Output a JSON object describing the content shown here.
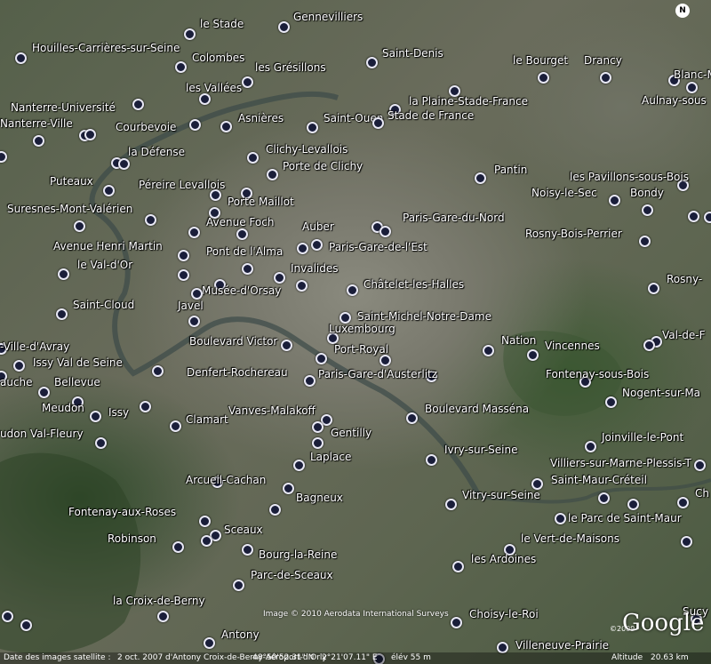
{
  "map": {
    "compass_letter": "N",
    "stations": [
      {
        "label": "le Stade",
        "dot": [
          212,
          37
        ],
        "text": [
          225,
          20
        ]
      },
      {
        "label": "Gennevilliers",
        "dot": [
          318,
          29
        ],
        "text": [
          330,
          12
        ]
      },
      {
        "label": "Houilles-Carrières-sur-Seine",
        "dot": [
          22,
          64
        ],
        "text": [
          36,
          47
        ]
      },
      {
        "label": "Colombes",
        "dot": [
          202,
          74
        ],
        "text": [
          216,
          58
        ]
      },
      {
        "label": "les Grésillons",
        "dot": [
          277,
          91
        ],
        "text": [
          287,
          69
        ]
      },
      {
        "label": "Saint-Denis",
        "dot": [
          417,
          69
        ],
        "text": [
          430,
          53
        ]
      },
      {
        "label": "le Bourget",
        "dot": [
          610,
          86
        ],
        "text": [
          577,
          61
        ]
      },
      {
        "label": "Drancy",
        "dot": [
          680,
          86
        ],
        "text": [
          657,
          61
        ]
      },
      {
        "label": "Blanc-M",
        "dot": [
          757,
          89
        ],
        "text": [
          758,
          77
        ]
      },
      {
        "label": "les Vallées",
        "dot": [
          229,
          110
        ],
        "text": [
          209,
          92
        ]
      },
      {
        "label": "Aulnay-sous",
        "dot": [
          777,
          97
        ],
        "text": [
          722,
          106
        ]
      },
      {
        "label": "Nanterre-Université",
        "dot": [
          154,
          116
        ],
        "text": [
          12,
          114
        ]
      },
      {
        "label": "la Plaine-Stade-France",
        "dot": [
          510,
          101
        ],
        "text": [
          460,
          107
        ]
      },
      {
        "label": "Asnières",
        "dot": [
          253,
          141
        ],
        "text": [
          268,
          126
        ]
      },
      {
        "label": "Saint-Ouen",
        "dot": [
          350,
          142
        ],
        "text": [
          364,
          126
        ]
      },
      {
        "label": "Stade de France",
        "dot": [
          443,
          122
        ],
        "text": [
          436,
          123
        ]
      },
      {
        "label": "Nanterre-Ville",
        "dot": [
          94,
          151
        ],
        "text": [
          0,
          132
        ]
      },
      {
        "label": "Courbevoie",
        "dot": [
          218,
          139
        ],
        "text": [
          130,
          136
        ]
      },
      {
        "label": "",
        "dot": [
          100,
          150
        ]
      },
      {
        "label": "",
        "dot": [
          424,
          137
        ]
      },
      {
        "label": "Clichy-Levallois",
        "dot": [
          283,
          176
        ],
        "text": [
          299,
          161
        ]
      },
      {
        "label": "",
        "dot": [
          42,
          157
        ]
      },
      {
        "label": "la Défense",
        "dot": [
          130,
          182
        ],
        "text": [
          144,
          164
        ]
      },
      {
        "label": "",
        "dot": [
          0,
          175
        ]
      },
      {
        "label": "",
        "dot": [
          138,
          183
        ]
      },
      {
        "label": "Porte de Clichy",
        "dot": [
          305,
          195
        ],
        "text": [
          318,
          180
        ]
      },
      {
        "label": "Pantin",
        "dot": [
          539,
          199
        ],
        "text": [
          556,
          184
        ]
      },
      {
        "label": "les Pavillons-sous-Bois",
        "dot": [
          767,
          207
        ],
        "text": [
          641,
          192
        ]
      },
      {
        "label": "Puteaux",
        "dot": [
          121,
          213
        ],
        "text": [
          56,
          197
        ]
      },
      {
        "label": "Péreire Levallois",
        "dot": [
          241,
          218
        ],
        "text": [
          156,
          201
        ]
      },
      {
        "label": "Noisy-le-Sec",
        "dot": [
          690,
          224
        ],
        "text": [
          598,
          210
        ]
      },
      {
        "label": "Bondy",
        "dot": [
          727,
          235
        ],
        "text": [
          709,
          210
        ]
      },
      {
        "label": "Porte Maillot",
        "dot": [
          276,
          216
        ],
        "text": [
          256,
          220
        ]
      },
      {
        "label": "Suresnes-Mont-Valérien",
        "dot": [
          168,
          246
        ],
        "text": [
          8,
          228
        ]
      },
      {
        "label": "",
        "dot": [
          240,
          238
        ]
      },
      {
        "label": "Avenue Foch",
        "dot": [
          271,
          262
        ],
        "text": [
          232,
          243
        ]
      },
      {
        "label": "Auber",
        "dot": [
          339,
          278
        ],
        "text": [
          340,
          248
        ]
      },
      {
        "label": "Paris-Gare-du-Nord",
        "dot": [
          423,
          254
        ],
        "text": [
          453,
          238
        ]
      },
      {
        "label": "",
        "dot": [
          432,
          259
        ]
      },
      {
        "label": "",
        "dot": [
          779,
          242
        ]
      },
      {
        "label": "",
        "dot": [
          797,
          243
        ]
      },
      {
        "label": "Avenue Henri Martin",
        "dot": [
          217,
          260
        ],
        "text": [
          60,
          270
        ]
      },
      {
        "label": "",
        "dot": [
          88,
          253
        ]
      },
      {
        "label": "Rosny-Bois-Perrier",
        "dot": [
          724,
          270
        ],
        "text": [
          591,
          256
        ]
      },
      {
        "label": "Paris-Gare-de-l'Est",
        "dot": [
          355,
          274
        ],
        "text": [
          370,
          271
        ]
      },
      {
        "label": "Pont de l'Alma",
        "dot": [
          277,
          301
        ],
        "text": [
          232,
          276
        ]
      },
      {
        "label": "",
        "dot": [
          205,
          286
        ]
      },
      {
        "label": "le Val-d'Or",
        "dot": [
          70,
          307
        ],
        "text": [
          87,
          291
        ]
      },
      {
        "label": "Invalides",
        "dot": [
          313,
          311
        ],
        "text": [
          327,
          295
        ]
      },
      {
        "label": "",
        "dot": [
          205,
          308
        ]
      },
      {
        "label": "Rosny-",
        "dot": [
          734,
          323
        ],
        "text": [
          750,
          307
        ]
      },
      {
        "label": "Musée-d'Orsay",
        "dot": [
          246,
          319
        ],
        "text": [
          227,
          320
        ]
      },
      {
        "label": "",
        "dot": [
          338,
          320
        ]
      },
      {
        "label": "Châtelet-les-Halles",
        "dot": [
          395,
          325
        ],
        "text": [
          409,
          313
        ]
      },
      {
        "label": "",
        "dot": [
          220,
          329
        ]
      },
      {
        "label": "Saint-Cloud",
        "dot": [
          68,
          352
        ],
        "text": [
          82,
          336
        ]
      },
      {
        "label": "Javel",
        "dot": [
          217,
          360
        ],
        "text": [
          200,
          337
        ]
      },
      {
        "label": "Saint-Michel-Notre-Dame",
        "dot": [
          387,
          356
        ],
        "text": [
          402,
          349
        ]
      },
      {
        "label": "Luxembourg",
        "dot": [
          373,
          379
        ],
        "text": [
          370,
          363
        ]
      },
      {
        "label": "Nation",
        "dot": [
          548,
          393
        ],
        "text": [
          564,
          376
        ]
      },
      {
        "label": "Vincennes",
        "dot": [
          598,
          398
        ],
        "text": [
          613,
          382
        ]
      },
      {
        "label": "Val-de-F",
        "dot": [
          737,
          383
        ],
        "text": [
          745,
          370
        ]
      },
      {
        "label": "",
        "dot": [
          729,
          387
        ]
      },
      {
        "label": "-Ville-d'Avray",
        "dot": [
          0,
          391
        ],
        "text": [
          0,
          383
        ]
      },
      {
        "label": "Boulevard Victor",
        "dot": [
          321,
          387
        ],
        "text": [
          213,
          377
        ]
      },
      {
        "label": "Port-Royal",
        "dot": [
          360,
          402
        ],
        "text": [
          376,
          386
        ]
      },
      {
        "label": "",
        "dot": [
          432,
          404
        ]
      },
      {
        "label": "Issy Val de Seine",
        "dot": [
          20,
          410
        ],
        "text": [
          37,
          401
        ]
      },
      {
        "label": "",
        "dot": [
          176,
          416
        ]
      },
      {
        "label": "Denfert-Rochereau",
        "dot": [
          347,
          427
        ],
        "text": [
          210,
          412
        ]
      },
      {
        "label": "Paris-Gare-d'Austerlitz",
        "dot": [
          484,
          422
        ],
        "text": [
          358,
          414
        ]
      },
      {
        "label": "Fontenay-sous-Bois",
        "dot": [
          657,
          428
        ],
        "text": [
          614,
          414
        ]
      },
      {
        "label": "auche",
        "dot": [
          0,
          422
        ],
        "text": [
          0,
          423
        ]
      },
      {
        "label": "Bellevue",
        "dot": [
          48,
          440
        ],
        "text": [
          61,
          423
        ]
      },
      {
        "label": "Nogent-sur-Ma",
        "dot": [
          686,
          451
        ],
        "text": [
          700,
          435
        ]
      },
      {
        "label": "Meudon",
        "dot": [
          86,
          451
        ],
        "text": [
          47,
          452
        ]
      },
      {
        "label": "Issy",
        "dot": [
          106,
          467
        ],
        "text": [
          122,
          457
        ]
      },
      {
        "label": "Clamart",
        "dot": [
          196,
          478
        ],
        "text": [
          209,
          465
        ]
      },
      {
        "label": "Vanves-Malakoff",
        "dot": [
          366,
          471
        ],
        "text": [
          257,
          455
        ]
      },
      {
        "label": "",
        "dot": [
          162,
          456
        ]
      },
      {
        "label": "Boulevard Masséna",
        "dot": [
          462,
          469
        ],
        "text": [
          478,
          453
        ]
      },
      {
        "label": "",
        "dot": [
          356,
          479
        ]
      },
      {
        "label": "udon Val-Fleury",
        "dot": [
          112,
          497
        ],
        "text": [
          0,
          481
        ]
      },
      {
        "label": "Gentilly",
        "dot": [
          356,
          497
        ],
        "text": [
          372,
          480
        ]
      },
      {
        "label": "Joinville-le-Pont",
        "dot": [
          663,
          501
        ],
        "text": [
          677,
          485
        ]
      },
      {
        "label": "Ivry-sur-Seine",
        "dot": [
          484,
          516
        ],
        "text": [
          500,
          499
        ]
      },
      {
        "label": "Laplace",
        "dot": [
          335,
          522
        ],
        "text": [
          349,
          507
        ]
      },
      {
        "label": "Villiers-sur-Marne-Plessis-T",
        "dot": [
          786,
          522
        ],
        "text": [
          619,
          514
        ]
      },
      {
        "label": "Saint-Maur-Créteil",
        "dot": [
          603,
          543
        ],
        "text": [
          620,
          533
        ]
      },
      {
        "label": "Arcueil-Cachan",
        "dot": [
          243,
          541
        ],
        "text": [
          209,
          533
        ]
      },
      {
        "label": "Bagneux",
        "dot": [
          323,
          548
        ],
        "text": [
          333,
          553
        ]
      },
      {
        "label": "Vitry-sur-Seine",
        "dot": [
          506,
          566
        ],
        "text": [
          520,
          550
        ]
      },
      {
        "label": "",
        "dot": [
          678,
          559
        ]
      },
      {
        "label": "Ch",
        "dot": [
          767,
          564
        ],
        "text": [
          782,
          548
        ]
      },
      {
        "label": "Fontenay-aux-Roses",
        "dot": [
          308,
          572
        ],
        "text": [
          77,
          569
        ]
      },
      {
        "label": "",
        "dot": [
          711,
          566
        ]
      },
      {
        "label": "Sceaux",
        "dot": [
          241,
          601
        ],
        "text": [
          252,
          589
        ]
      },
      {
        "label": "le Parc de Saint-Maur",
        "dot": [
          629,
          582
        ],
        "text": [
          639,
          576
        ]
      },
      {
        "label": "",
        "dot": [
          229,
          585
        ]
      },
      {
        "label": "Robinson",
        "dot": [
          199,
          614
        ],
        "text": [
          121,
          599
        ]
      },
      {
        "label": "le Vert-de-Maisons",
        "dot": [
          572,
          617
        ],
        "text": [
          586,
          599
        ]
      },
      {
        "label": "",
        "dot": [
          771,
          608
        ]
      },
      {
        "label": "",
        "dot": [
          231,
          607
        ]
      },
      {
        "label": "Bourg-la-Reine",
        "dot": [
          277,
          617
        ],
        "text": [
          291,
          617
        ]
      },
      {
        "label": "les Ardoines",
        "dot": [
          514,
          636
        ],
        "text": [
          530,
          622
        ]
      },
      {
        "label": "Parc-de-Sceaux",
        "dot": [
          267,
          657
        ],
        "text": [
          282,
          640
        ]
      },
      {
        "label": "la Croix-de-Berny",
        "dot": [
          182,
          692
        ],
        "text": [
          127,
          669
        ]
      },
      {
        "label": "Sucy",
        "dot": [
          782,
          695
        ],
        "text": [
          768,
          681
        ]
      },
      {
        "label": "",
        "dot": [
          7,
          692
        ]
      },
      {
        "label": "",
        "dot": [
          28,
          702
        ]
      },
      {
        "label": "Choisy-le-Roi",
        "dot": [
          512,
          699
        ],
        "text": [
          528,
          684
        ]
      },
      {
        "label": "Antony",
        "dot": [
          234,
          722
        ],
        "text": [
          249,
          707
        ]
      },
      {
        "label": "Villeneuve-Prairie",
        "dot": [
          564,
          727
        ],
        "text": [
          580,
          719
        ]
      },
      {
        "label": "",
        "dot": [
          425,
          740
        ]
      }
    ]
  },
  "copyright": "Image © 2010 Aerodata International Surveys",
  "logo": {
    "text": "Google",
    "year": "©2009"
  },
  "statusbar": {
    "date_label": "Date des images satellite :",
    "date": "2 oct. 2007",
    "overlap": "d'Antony   Croix-de-Berny-Aéroport-d'Orly",
    "lat": "48°50'52.31\" N",
    "lon": "2°21'07.11\" E",
    "elev": "élév   55 m",
    "altitude_label": "Altitude",
    "altitude": "20.63 km"
  }
}
